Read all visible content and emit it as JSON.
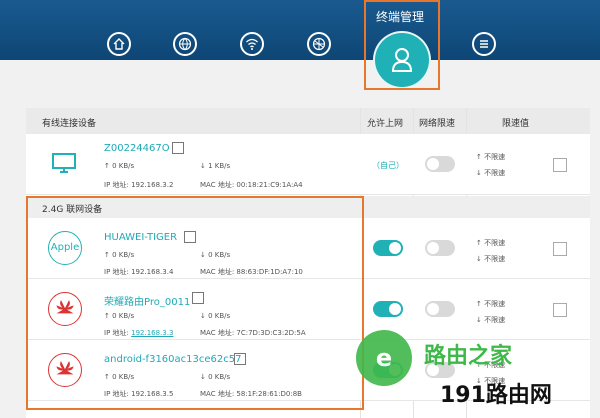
{
  "nav": {
    "active_title": "终端管理",
    "icons": [
      "home-icon",
      "globe-icon",
      "wifi-icon",
      "globe-settings-icon",
      "user-icon",
      "menu-icon"
    ]
  },
  "table": {
    "wired_label": "有线连接设备",
    "allow_col": "允许上网",
    "limit_col": "网络限速",
    "limit_value_col": "限速值"
  },
  "wired": {
    "name": "Z00224467O",
    "up": "0 KB/s",
    "down": "1 KB/s",
    "ip": "IP 地址: 192.168.3.2",
    "mac": "MAC 地址: 00:18:21:C9:1A:A4",
    "self": "（自己）",
    "lim_up": "不限速",
    "lim_down": "不限速"
  },
  "section_24g": "2.4G 联网设备",
  "devices": [
    {
      "badge": "Apple",
      "name": "HUAWEI-TIGER",
      "up": "0 KB/s",
      "down": "0 KB/s",
      "ip": "IP 地址: 192.168.3.4",
      "mac": "MAC 地址: 88:63:DF:1D:A7:10",
      "lim_up": "不限速",
      "lim_down": "不限速",
      "allow": true
    },
    {
      "badge": "huawei",
      "name": "荣耀路由Pro_0011",
      "up": "0 KB/s",
      "down": "0 KB/s",
      "ip_prefix": "IP 地址: ",
      "ip_link": "192.168.3.3",
      "mac": "MAC 地址: 7C:7D:3D:C3:2D:5A",
      "lim_up": "不限速",
      "lim_down": "不限速",
      "allow": true
    },
    {
      "badge": "huawei",
      "name": "android-f3160ac13ce62c57",
      "up": "0 KB/s",
      "down": "0 KB/s",
      "ip": "IP 地址: 192.168.3.5",
      "mac": "MAC 地址: 58:1F:28:61:D0:8B",
      "lim_up": "不限速",
      "lim_down": "不限速",
      "allow": true
    }
  ],
  "watermark": {
    "logo": "路由之家",
    "site": "191路由网"
  },
  "colors": {
    "accent": "#1fb1b5",
    "header": "#0d4675",
    "highlight": "#e8772e"
  }
}
